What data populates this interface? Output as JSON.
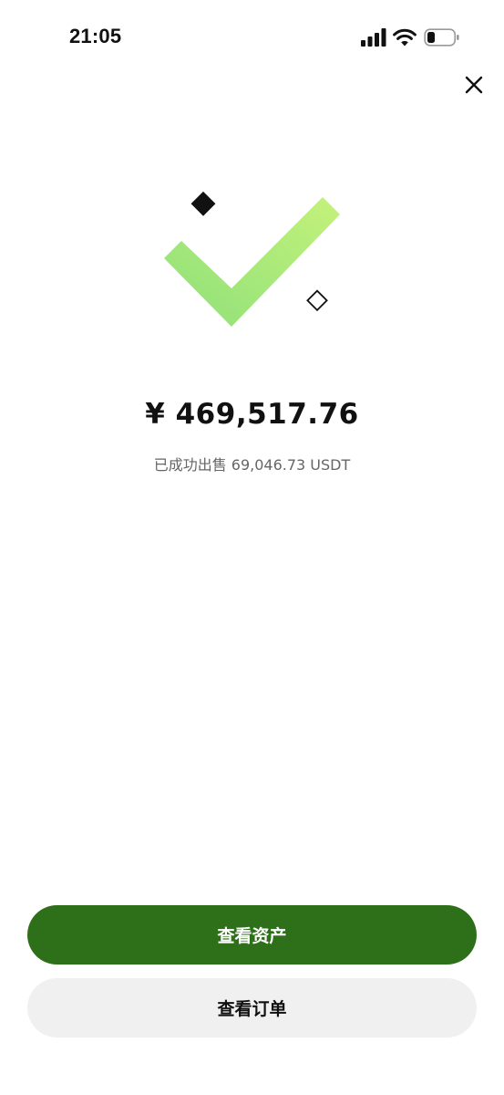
{
  "status_bar": {
    "time": "21:05"
  },
  "icons": {
    "signal": "cellular-signal-icon",
    "wifi": "wifi-icon",
    "battery": "battery-low-icon",
    "close": "close-icon",
    "success": "success-checkmark-icon"
  },
  "result": {
    "amount": "¥ 469,517.76",
    "description": "已成功出售 69,046.73 USDT"
  },
  "actions": {
    "view_assets_label": "查看资产",
    "view_orders_label": "查看订单"
  },
  "colors": {
    "primary_button": "#2e7019",
    "secondary_button": "#f0f0f0",
    "check_light": "#c4f27a",
    "check_dark": "#8ee07a"
  }
}
